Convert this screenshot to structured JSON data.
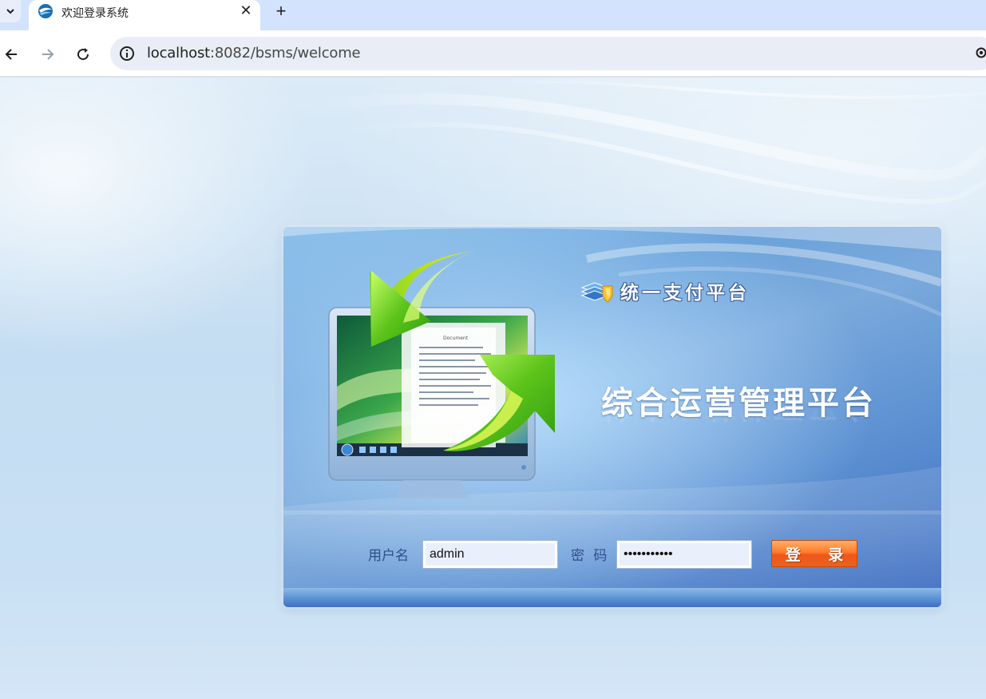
{
  "browser": {
    "tab_title": "欢迎登录系统",
    "url_host": "localhost",
    "url_rest": ":8082/bsms/welcome"
  },
  "panel": {
    "brand_name": "统一支付平台",
    "system_title": "综合运营管理平台",
    "monitor_doc_title": "Document"
  },
  "login": {
    "username_label": "用户名",
    "username_value": "admin",
    "password_label": "密 码",
    "password_value": "•••••••••••",
    "submit_label": "登 录"
  },
  "colors": {
    "accent_orange": "#f0561a",
    "panel_blue": "#5b8fd1",
    "arrow_green": "#5cc41a"
  }
}
